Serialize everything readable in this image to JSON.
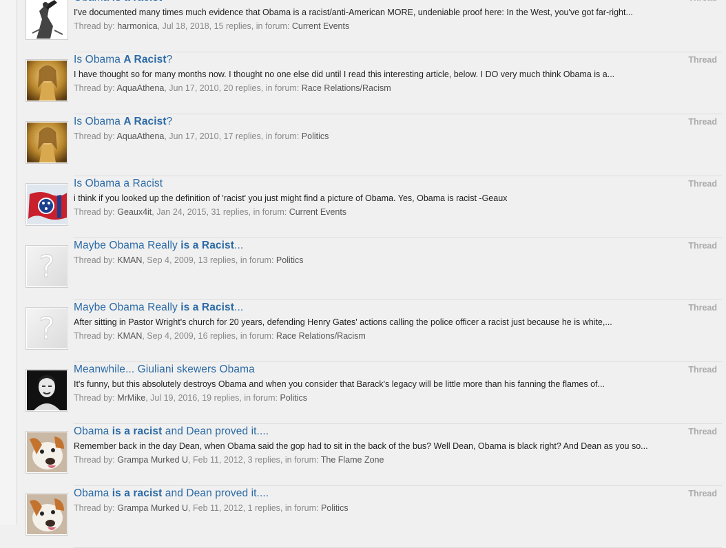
{
  "results": [
    {
      "avatar_icon": "sketch-figure-avatar",
      "title_parts": [
        [
          "Obama ",
          false
        ],
        [
          "is a racist",
          true
        ]
      ],
      "snippet": "I've documented many times much evidence that Obama is a racist/anti-American MORE, undeniable proof here: In the West, you've got far-right...",
      "meta_prefix": "Thread by: ",
      "author": "harmonica",
      "meta_mid": ", Jul 18, 2018, 15 replies, in forum: ",
      "forum": "Current Events",
      "type": "Thread"
    },
    {
      "avatar_icon": "golden-woman-avatar",
      "title_parts": [
        [
          "Is Obama ",
          false
        ],
        [
          "A Racist",
          true
        ],
        [
          "?",
          false
        ]
      ],
      "snippet": "I have thought so for many months now. I thought no one else did until I read this interesting article, below. I DO very much think Obama is a...",
      "meta_prefix": "Thread by: ",
      "author": "AquaAthena",
      "meta_mid": ", Jun 17, 2010, 20 replies, in forum: ",
      "forum": "Race Relations/Racism",
      "type": "Thread"
    },
    {
      "avatar_icon": "golden-woman-avatar",
      "title_parts": [
        [
          "Is Obama ",
          false
        ],
        [
          "A Racist",
          true
        ],
        [
          "?",
          false
        ]
      ],
      "snippet": "",
      "meta_prefix": "Thread by: ",
      "author": "AquaAthena",
      "meta_mid": ", Jun 17, 2010, 17 replies, in forum: ",
      "forum": "Politics",
      "type": "Thread"
    },
    {
      "avatar_icon": "tennessee-flag-avatar",
      "title_parts": [
        [
          "Is Obama a Racist",
          false
        ]
      ],
      "snippet": "i think if you looked up the definition of 'racist' you just might find a picture of Obama. Yes, Obama is racist -Geaux",
      "meta_prefix": "Thread by: ",
      "author": "Geaux4it",
      "meta_mid": ", Jan 24, 2015, 31 replies, in forum: ",
      "forum": "Current Events",
      "type": "Thread"
    },
    {
      "avatar_icon": "question-mark-avatar",
      "title_parts": [
        [
          "Maybe Obama Really ",
          false
        ],
        [
          "is a Racist",
          true
        ],
        [
          "...",
          false
        ]
      ],
      "snippet": "",
      "meta_prefix": "Thread by: ",
      "author": "KMAN",
      "meta_mid": ", Sep 4, 2009, 13 replies, in forum: ",
      "forum": "Politics",
      "type": "Thread"
    },
    {
      "avatar_icon": "question-mark-avatar",
      "title_parts": [
        [
          "Maybe Obama Really ",
          false
        ],
        [
          "is a Racist",
          true
        ],
        [
          "...",
          false
        ]
      ],
      "snippet": "After sitting in Pastor Wright's church for 20 years, defending Henry Gates' actions calling the police officer a racist just because he is white,...",
      "meta_prefix": "Thread by: ",
      "author": "KMAN",
      "meta_mid": ", Sep 4, 2009, 16 replies, in forum: ",
      "forum": "Race Relations/Racism",
      "type": "Thread"
    },
    {
      "avatar_icon": "man-portrait-avatar",
      "title_parts": [
        [
          "Meanwhile... Giuliani skewers Obama",
          false
        ]
      ],
      "snippet": "It's funny, but this absolutely destroys Obama and when you consider that Barack's legacy will be little more than his fanning the flames of...",
      "meta_prefix": "Thread by: ",
      "author": "MrMike",
      "meta_mid": ", Jul 19, 2016, 19 replies, in forum: ",
      "forum": "Politics",
      "type": "Thread"
    },
    {
      "avatar_icon": "dog-avatar",
      "title_parts": [
        [
          "Obama ",
          false
        ],
        [
          "is a racist",
          true
        ],
        [
          " and Dean proved it....",
          false
        ]
      ],
      "snippet": "Remember back in the day Dean, when Obama said the gop had to sit in the back of the bus? Well Dean, Obama is black right? And Dean as you so...",
      "meta_prefix": "Thread by: ",
      "author": "Grampa Murked U",
      "meta_mid": ", Feb 11, 2012, 3 replies, in forum: ",
      "forum": "The Flame Zone",
      "type": "Thread"
    },
    {
      "avatar_icon": "dog-avatar",
      "title_parts": [
        [
          "Obama ",
          false
        ],
        [
          "is a racist",
          true
        ],
        [
          " and Dean proved it....",
          false
        ]
      ],
      "snippet": "",
      "meta_prefix": "Thread by: ",
      "author": "Grampa Murked U",
      "meta_mid": ", Feb 11, 2012, 1 replies, in forum: ",
      "forum": "Politics",
      "type": "Thread"
    }
  ],
  "colors": {
    "title_link": "#2b6aa5",
    "meta_text": "#888888",
    "type_label": "#aaaaaa",
    "background": "#f0f0f0"
  }
}
